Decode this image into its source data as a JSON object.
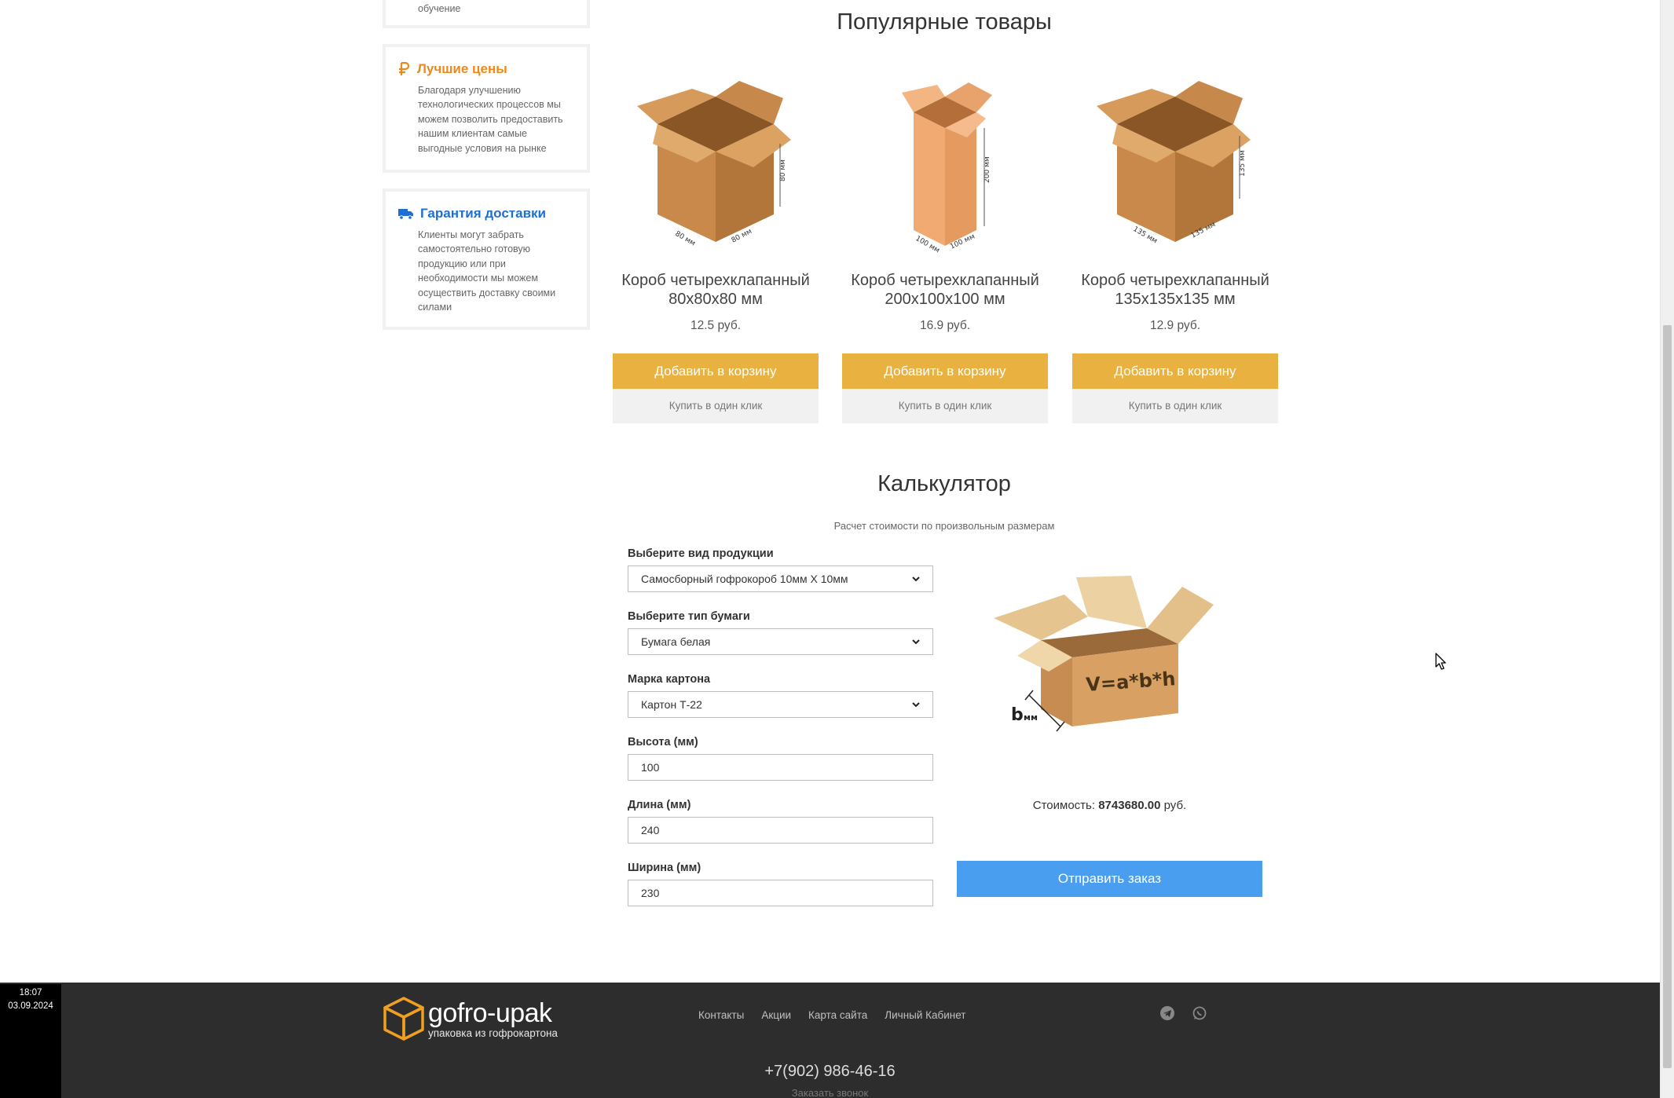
{
  "sidebar": {
    "top_card": {
      "desc": "обучение"
    },
    "prices": {
      "icon": "ruble-icon",
      "title": "Лучшие цены",
      "desc": "Благодаря улучшению технологических процессов мы можем позволить предоставить нашим клиентам самые выгодные условия на рынке"
    },
    "delivery": {
      "icon": "truck-icon",
      "title": "Гарантия доставки",
      "desc": "Клиенты могут забрать самостоятельно готовую продукцию или при необходимости мы можем осуществить доставку своими силами"
    }
  },
  "popular": {
    "title": "Популярные товары",
    "products": [
      {
        "name": "Короб четырехклапанный 80х80х80 мм",
        "price": "12.5 руб.",
        "cart_label": "Добавить в корзину",
        "oneclick_label": "Купить в один клик",
        "dims": [
          "80 мм",
          "80 мм",
          "80 мм"
        ]
      },
      {
        "name": "Короб четырехклапанный 200х100х100 мм",
        "price": "16.9 руб.",
        "cart_label": "Добавить в корзину",
        "oneclick_label": "Купить в один клик",
        "dims": [
          "200 мм",
          "100 мм",
          "100 мм"
        ]
      },
      {
        "name": "Короб четырехклапанный 135х135х135 мм",
        "price": "12.9 руб.",
        "cart_label": "Добавить в корзину",
        "oneclick_label": "Купить в один клик",
        "dims": [
          "135 мм",
          "135 мм",
          "135 мм"
        ]
      }
    ]
  },
  "calculator": {
    "title": "Калькулятор",
    "subtitle": "Расчет стоимости по произвольным размерам",
    "product_type": {
      "label": "Выберите вид продукции",
      "value": "Самосборный гофрокороб 10мм X 10мм"
    },
    "paper_type": {
      "label": "Выберите тип бумаги",
      "value": "Бумага белая"
    },
    "cardboard": {
      "label": "Марка картона",
      "value": "Картон Т-22"
    },
    "height": {
      "label": "Высота (мм)",
      "value": "100"
    },
    "length": {
      "label": "Длина (мм)",
      "value": "240"
    },
    "width": {
      "label": "Ширина (мм)",
      "value": "230"
    },
    "image": {
      "formula": "V=a*b*h",
      "b_label": "b",
      "b_unit": "мм"
    },
    "cost_prefix": "Стоимость:",
    "cost_value": "8743680.00",
    "cost_suffix": "руб.",
    "submit_label": "Отправить заказ"
  },
  "footer": {
    "brand": "gofro-upak",
    "tagline": "упаковка из гофрокартона",
    "nav": [
      "Контакты",
      "Акции",
      "Карта сайта",
      "Личный Кабинет"
    ],
    "social": [
      "telegram-icon",
      "whatsapp-icon"
    ],
    "phone": "+7(902) 986-46-16",
    "callback": "Заказать звонок"
  },
  "clock": {
    "time": "18:07",
    "date": "03.09.2024"
  },
  "colors": {
    "accent": "#e9b13f",
    "send": "#4a9ef0",
    "prices_title": "#e98a1e",
    "delivery_title": "#1d6fd4",
    "footer_bg": "#2d2d2d"
  }
}
